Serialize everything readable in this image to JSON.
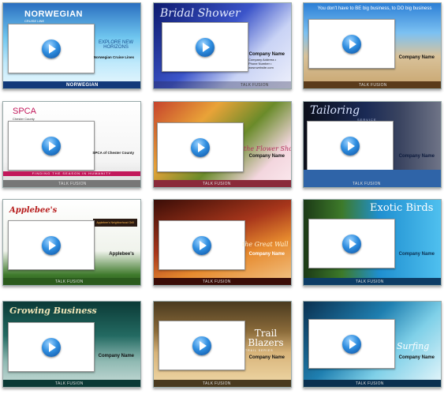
{
  "cards": [
    {
      "id": "norwegian",
      "title": "NORWEGIAN",
      "subtitle": "CRUISE LINE",
      "tagline": "EXPLORE NEW HORIZONS",
      "company": "Norwegian Cruise Lines",
      "footer": "NORWEGIAN"
    },
    {
      "id": "bridal",
      "title": "Bridal Shower",
      "company": "Company Name",
      "footer": "TALK FUSION"
    },
    {
      "id": "business",
      "title": "You don't have to BE big business, to DO big business",
      "company": "Company Name",
      "footer": "TALK FUSION"
    },
    {
      "id": "spca",
      "title": "SPCA",
      "subtitle": "Chester County",
      "company": "SPCA of Chester County",
      "banner": "FINDING THE SEASON IN HUMANITY",
      "footer": "TALK FUSION"
    },
    {
      "id": "flower",
      "title": "the Flower Shop",
      "company": "Company Name",
      "footer": "TALK FUSION"
    },
    {
      "id": "tailoring",
      "title": "Tailoring",
      "subtitle": "SERVICE",
      "company": "Company Name",
      "footer": "TALK FUSION"
    },
    {
      "id": "applebees",
      "title": "Applebee's",
      "sign": "Applebee's Neighborhood Grill",
      "company": "Applebee's",
      "footer": "TALK FUSION"
    },
    {
      "id": "greatwall",
      "title": "the Great Wall",
      "company": "Company Name",
      "footer": "TALK FUSION"
    },
    {
      "id": "exoticbirds",
      "title": "Exotic Birds",
      "company": "Company Name",
      "footer": "TALK FUSION"
    },
    {
      "id": "growing",
      "title": "Growing Business",
      "company": "Company Name",
      "footer": "TALK FUSION"
    },
    {
      "id": "trail",
      "title": "Trail Blazers",
      "subtitle": "TRAIL SERIES",
      "company": "Company Name",
      "footer": "TALK FUSION"
    },
    {
      "id": "surfing",
      "title": "Surfing",
      "company": "Company Name",
      "footer": "TALK FUSION"
    }
  ],
  "contact_lines": "Company Address • Phone Number • www.website.com"
}
